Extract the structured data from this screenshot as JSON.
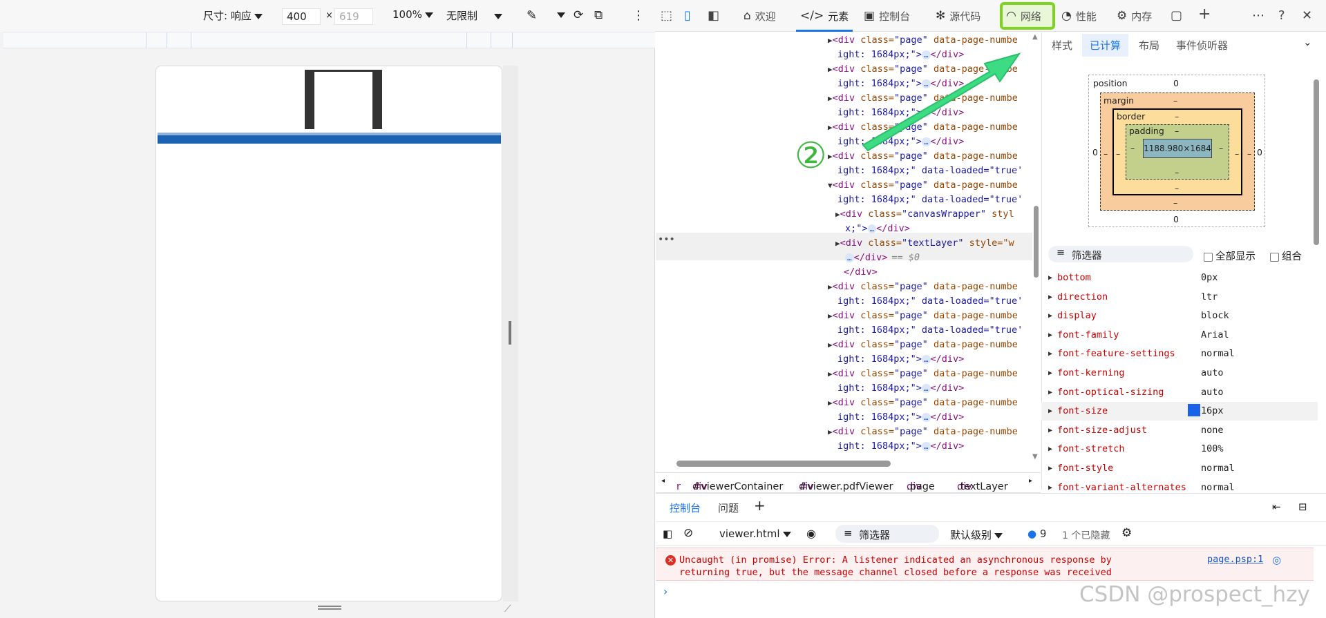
{
  "device_toolbar": {
    "size_label": "尺寸: 响应",
    "width": "400",
    "height_placeholder": "619",
    "zoom": "100%",
    "throttle": "无限制"
  },
  "devtools": {
    "tabs": [
      {
        "label": "欢迎",
        "icon": "home-icon"
      },
      {
        "label": "元素",
        "icon": "code-icon"
      },
      {
        "label": "控制台",
        "icon": "console-icon"
      },
      {
        "label": "源代码",
        "icon": "bug-icon"
      },
      {
        "label": "网络",
        "icon": "wifi-icon"
      },
      {
        "label": "性能",
        "icon": "gauge-icon"
      },
      {
        "label": "内存",
        "icon": "gear-icon"
      }
    ],
    "annotation": "②",
    "elements": {
      "lines": [
        {
          "a": "<div",
          "c": " class=",
          "v": "\"page\"",
          "r": " data-page-numbe",
          "t": "▶"
        },
        {
          "w": "ight: 1684px;\">",
          "e": "…",
          "end": "</div>"
        },
        {
          "a": "<div",
          "c": " class=",
          "v": "\"page\"",
          "r": " data-page-numbe",
          "t": "▶"
        },
        {
          "w": "ight: 1684px;\">",
          "e": "…",
          "end": "</div>"
        },
        {
          "a": "<div",
          "c": " class=",
          "v": "\"page\"",
          "r": " data-page-numbe",
          "t": "▶"
        },
        {
          "w": "ight: 1684px;\">",
          "e": "…",
          "end": "</div>"
        },
        {
          "a": "<div",
          "c": " class=",
          "v": "\"page\"",
          "r": " data-page-numbe",
          "t": "▶"
        },
        {
          "w": "ight: 1684px;\">",
          "e": "…",
          "end": "</div>"
        },
        {
          "a": "<div",
          "c": " class=",
          "v": "\"page\"",
          "r": " data-page-numbe",
          "t": "▶"
        },
        {
          "w": "ight: 1684px;\" data-loaded=\"true'"
        },
        {
          "a": "<div",
          "c": " class=",
          "v": "\"page\"",
          "r": " data-page-numbe",
          "t": "▼"
        },
        {
          "w": "ight: 1684px;\" data-loaded=\"true'"
        },
        {
          "a": "<div",
          "c": " class=",
          "v": "\"canvasWrapper\"",
          "r": " styl",
          "t": "▶"
        },
        {
          "w": "x;\">",
          "e": "…",
          "end": "</div>"
        },
        {
          "a": "<div",
          "c": " class=",
          "v": "\"textLayer\"",
          "r": " style=\"w",
          "t": "▶"
        },
        {
          "w": "",
          "e": "…",
          "end": "</div>",
          "cm": "== $0"
        },
        {
          "w": "</div>"
        },
        {
          "a": "<div",
          "c": " class=",
          "v": "\"page\"",
          "r": " data-page-numbe",
          "t": "▶"
        },
        {
          "w": "ight: 1684px;\" data-loaded=\"true'"
        },
        {
          "a": "<div",
          "c": " class=",
          "v": "\"page\"",
          "r": " data-page-numbe",
          "t": "▶"
        },
        {
          "w": "ight: 1684px;\" data-loaded=\"true'"
        },
        {
          "a": "<div",
          "c": " class=",
          "v": "\"page\"",
          "r": " data-page-numbe",
          "t": "▶"
        },
        {
          "w": "ight: 1684px;\">",
          "e": "…",
          "end": "</div>"
        },
        {
          "a": "<div",
          "c": " class=",
          "v": "\"page\"",
          "r": " data-page-numbe",
          "t": "▶"
        },
        {
          "w": "ight: 1684px;\">",
          "e": "…",
          "end": "</div>"
        },
        {
          "a": "<div",
          "c": " class=",
          "v": "\"page\"",
          "r": " data-page-numbe",
          "t": "▶"
        },
        {
          "w": "ight: 1684px;\">",
          "e": "…",
          "end": "</div>"
        },
        {
          "a": "<div",
          "c": " class=",
          "v": "\"page\"",
          "r": " data-page-numbe",
          "t": "▶"
        },
        {
          "w": "ight: 1684px;\">",
          "e": "…",
          "end": "</div>"
        }
      ],
      "crumbs": [
        {
          "tag": "r",
          "rest": ""
        },
        {
          "tag": "div",
          "rest": "#viewerContainer"
        },
        {
          "tag": "div",
          "rest": "#viewer.pdfViewer"
        },
        {
          "tag": "div",
          "rest": ".page"
        },
        {
          "tag": "div",
          "rest": ".textLayer"
        }
      ]
    },
    "styles": {
      "tabs": [
        "样式",
        "已计算",
        "布局",
        "事件侦听器"
      ],
      "box_model": {
        "position": "position",
        "position_top": "0",
        "position_left": "0",
        "position_right": "0",
        "position_bottom": "0",
        "margin": "margin",
        "border": "border",
        "padding": "padding",
        "dash": "–",
        "content": "1188.980×1684"
      },
      "filter": "筛选器",
      "show_all": "全部显示",
      "group": "组合",
      "props": [
        {
          "n": "bottom",
          "v": "0px"
        },
        {
          "n": "direction",
          "v": "ltr"
        },
        {
          "n": "display",
          "v": "block"
        },
        {
          "n": "font-family",
          "v": "Arial"
        },
        {
          "n": "font-feature-settings",
          "v": "normal"
        },
        {
          "n": "font-kerning",
          "v": "auto"
        },
        {
          "n": "font-optical-sizing",
          "v": "auto"
        },
        {
          "n": "font-size",
          "v": "16px"
        },
        {
          "n": "font-size-adjust",
          "v": "none"
        },
        {
          "n": "font-stretch",
          "v": "100%"
        },
        {
          "n": "font-style",
          "v": "normal"
        },
        {
          "n": "font-variant-alternates",
          "v": "normal"
        }
      ]
    },
    "drawer": {
      "tabs": [
        "控制台",
        "问题"
      ],
      "context": "viewer.html",
      "filter": "筛选器",
      "level": "默认级别",
      "msg_count": "9",
      "hidden": "1 个已隐藏"
    },
    "console": {
      "error_text": "Uncaught (in promise) Error: A listener indicated an asynchronous response by returning true, but the message channel closed before a response was received",
      "source": "page.psp:1"
    }
  },
  "watermark": "CSDN @prospect_hzy",
  "colors": {
    "accent": "#1a73e8",
    "highlight": "#7ed321",
    "error": "#d93025"
  }
}
